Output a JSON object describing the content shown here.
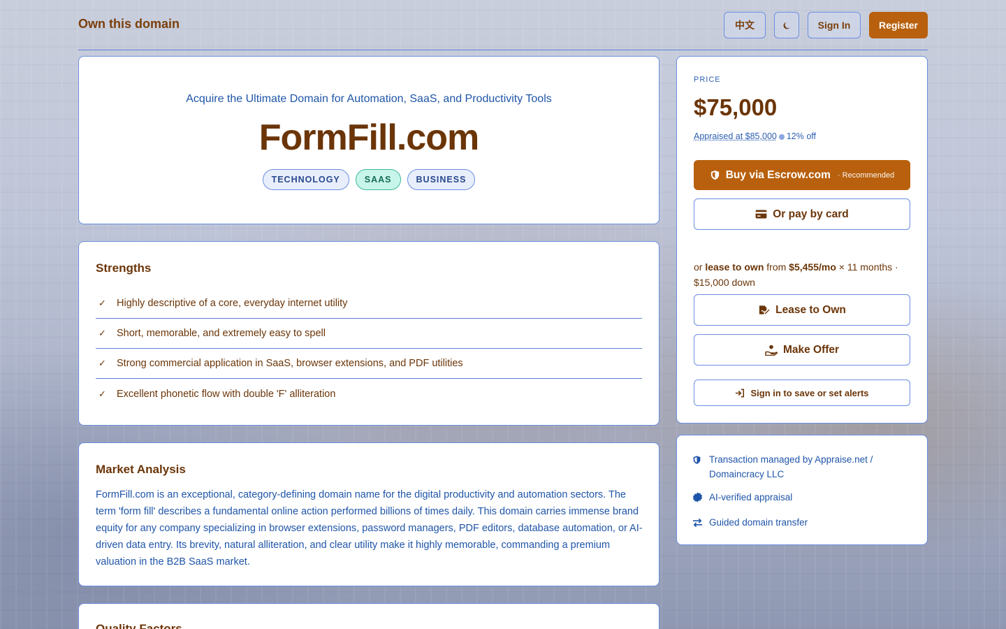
{
  "header": {
    "site_title": "Own this domain",
    "lang_label": "中文",
    "theme_icon": "moon-icon",
    "signin_label": "Sign In",
    "register_label": "Register"
  },
  "hero": {
    "tagline": "Acquire the Ultimate Domain for Automation, SaaS, and Productivity Tools",
    "domain": "FormFill.com",
    "tags": [
      "TECHNOLOGY",
      "SAAS",
      "BUSINESS"
    ]
  },
  "strengths": {
    "title": "Strengths",
    "items": [
      "Highly descriptive of a core, everyday internet utility",
      "Short, memorable, and extremely easy to spell",
      "Strong commercial application in SaaS, browser extensions, and PDF utilities",
      "Excellent phonetic flow with double 'F' alliteration"
    ]
  },
  "market": {
    "title": "Market Analysis",
    "text": "FormFill.com is an exceptional, category-defining domain name for the digital productivity and automation sectors. The term 'form fill' describes a fundamental online action performed billions of times daily. This domain carries immense brand equity for any company specializing in browser extensions, password managers, PDF editors, database automation, or AI-driven data entry. Its brevity, natural alliteration, and clear utility make it highly memorable, commanding a premium valuation in the B2B SaaS market."
  },
  "quality": {
    "title": "Quality Factors"
  },
  "pricing": {
    "label": "PRICE",
    "price": "$75,000",
    "appraised": "Appraised at $85,000",
    "discount": "12% off",
    "escrow_label": "Buy via Escrow.com",
    "escrow_badge": "· Recommended",
    "card_label": "Or pay by card",
    "lease": {
      "prefix": "or",
      "strong": "lease to own",
      "from": "from",
      "monthly": "$5,455/mo",
      "terms": "× 11 months · $15,000 down"
    },
    "lease_button": "Lease to Own",
    "offer_button": "Make Offer",
    "save_button": "Sign in to save or set alerts"
  },
  "trust": {
    "items": [
      {
        "icon": "shield-icon",
        "text": "Transaction managed by Appraise.net / Domaincracy LLC"
      },
      {
        "icon": "badge-check-icon",
        "text": "AI-verified appraisal"
      },
      {
        "icon": "transfer-arrows-icon",
        "text": "Guided domain transfer"
      }
    ]
  },
  "colors": {
    "brand": "#b8600d",
    "text_brown": "#6b3508",
    "link_blue": "#1f55a8",
    "border_blue": "#6b8ee0"
  }
}
